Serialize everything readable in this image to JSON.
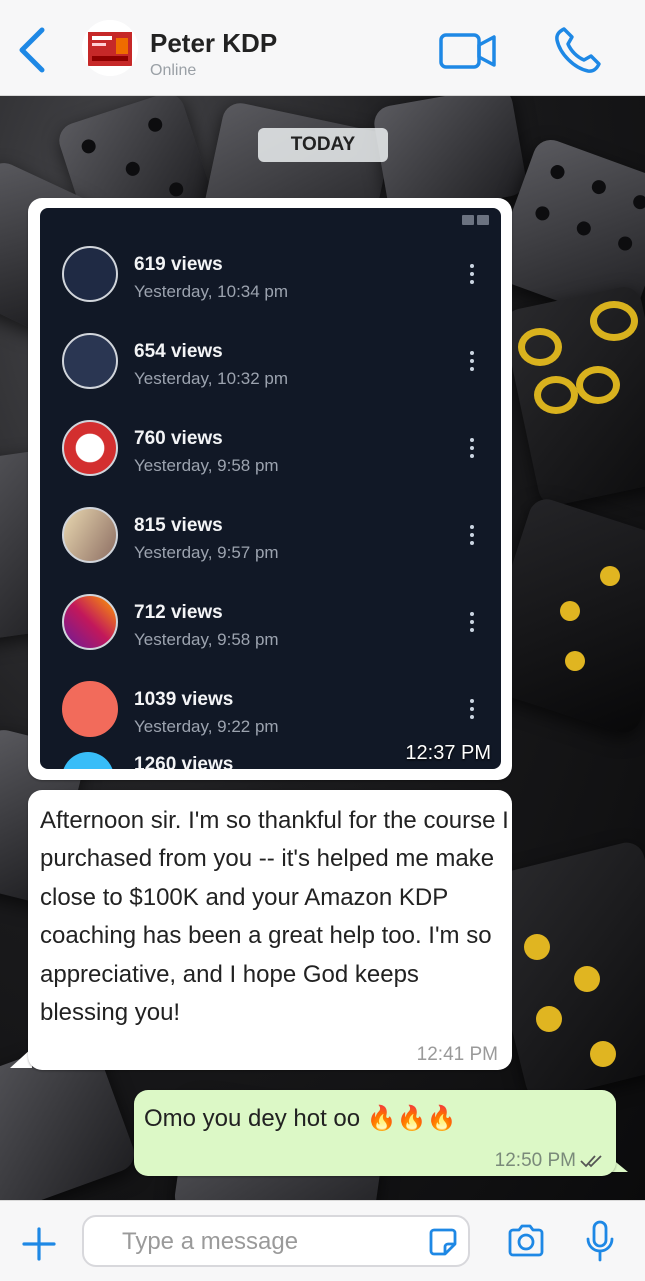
{
  "contact": {
    "name": "Peter KDP",
    "status": "Online"
  },
  "date_divider": "TODAY",
  "image_message": {
    "rows": [
      {
        "views": "619 views",
        "time": "Yesterday, 10:34 pm"
      },
      {
        "views": "654 views",
        "time": "Yesterday, 10:32 pm"
      },
      {
        "views": "760 views",
        "time": "Yesterday, 9:58 pm"
      },
      {
        "views": "815 views",
        "time": "Yesterday, 9:57 pm"
      },
      {
        "views": "712 views",
        "time": "Yesterday, 9:58 pm"
      },
      {
        "views": "1039 views",
        "time": "Yesterday, 9:22 pm"
      }
    ],
    "partial_row": "1260 views",
    "timestamp": "12:37 PM"
  },
  "incoming_message": {
    "text": "Afternoon sir. I'm so thankful for the course I purchased from you -- it's helped me make close to $100K and your Amazon KDP coaching has been a great help too. I'm so appreciative, and I hope God keeps blessing you!",
    "timestamp": "12:41 PM"
  },
  "outgoing_message": {
    "text": "Omo you dey hot oo 🔥🔥🔥",
    "timestamp": "12:50 PM"
  },
  "input": {
    "placeholder": "Type a message"
  },
  "colors": {
    "accent": "#1e88e5",
    "outgoing_bubble": "#dcf8c6",
    "incoming_bubble": "#ffffff"
  },
  "icons": [
    "back-icon",
    "video-call-icon",
    "phone-icon",
    "plus-icon",
    "sticker-icon",
    "camera-icon",
    "microphone-icon",
    "double-check-icon"
  ]
}
